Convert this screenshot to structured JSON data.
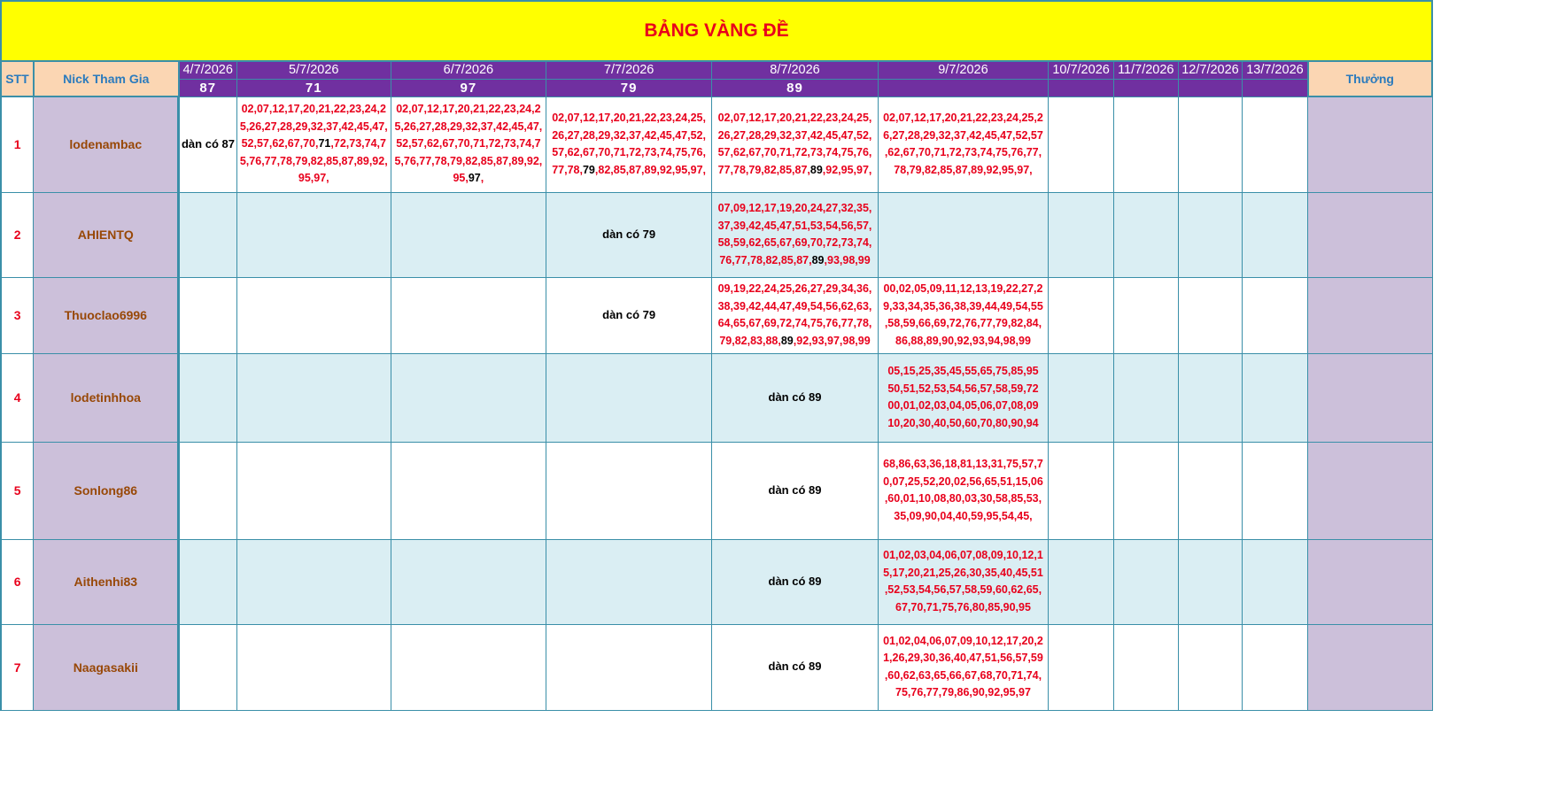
{
  "title": "BẢNG VÀNG ĐỀ",
  "headers": {
    "stt": "STT",
    "nick": "Nick Tham Gia",
    "reward": "Thưởng"
  },
  "dates": [
    "4/7/2026",
    "5/7/2026",
    "6/7/2026",
    "7/7/2026",
    "8/7/2026",
    "9/7/2026",
    "10/7/2026",
    "11/7/2026",
    "12/7/2026",
    "13/7/2026"
  ],
  "results": [
    "87",
    "71",
    "97",
    "79",
    "89",
    "",
    "",
    "",
    "",
    ""
  ],
  "rows": [
    {
      "stt": "1",
      "nick": "lodenambac",
      "cells": [
        {
          "note": "dàn có 87"
        },
        {
          "parts": [
            "02,07,12,17,20,21,22,23,24,25,26,27,28,29,32,37,42,45,47,52,57,62,67,70,",
            "71",
            ",72,73,74,75,76,77,78,79,82,85,87,89,92,95,97,"
          ]
        },
        {
          "parts": [
            "02,07,12,17,20,21,22,23,24,25,26,27,28,29,32,37,42,45,47,52,57,62,67,70,71,72,73,74,75,76,77,78,79,82,85,87,89,92,95,",
            "97",
            ","
          ]
        },
        {
          "parts": [
            "02,07,12,17,20,21,22,23,24,25,26,27,28,29,32,37,42,45,47,52,57,62,67,70,71,72,73,74,75,76,77,78,",
            "79",
            ",82,85,87,89,92,95,97,"
          ]
        },
        {
          "parts": [
            "02,07,12,17,20,21,22,23,24,25,26,27,28,29,32,37,42,45,47,52,57,62,67,70,71,72,73,74,75,76,77,78,79,82,85,87,",
            "89",
            ",92,95,97,"
          ]
        },
        {
          "parts": [
            "02,07,12,17,20,21,22,23,24,25,26,27,28,29,32,37,42,45,47,52,57,62,67,70,71,72,73,74,75,76,77,78,79,82,85,87,89,92,95,97,"
          ]
        },
        {},
        {},
        {},
        {}
      ]
    },
    {
      "stt": "2",
      "nick": "AHIENTQ",
      "cells": [
        {},
        {},
        {},
        {
          "note": "dàn có 79"
        },
        {
          "parts": [
            "07,09,12,17,19,20,24,27,32,35,37,39,42,45,47,51,53,54,56,57,58,59,62,65,67,69,70,72,73,74,76,77,78,82,85,87,",
            "89",
            ",93,98,99"
          ]
        },
        {},
        {},
        {},
        {},
        {}
      ]
    },
    {
      "stt": "3",
      "nick": "Thuoclao6996",
      "cells": [
        {},
        {},
        {},
        {
          "note": "dàn có 79"
        },
        {
          "parts": [
            "09,19,22,24,25,26,27,29,34,36,38,39,42,44,47,49,54,56,62,63,64,65,67,69,72,74,75,76,77,78,79,82,83,88,",
            "89",
            ",92,93,97,98,99"
          ]
        },
        {
          "parts": [
            "00,02,05,09,11,12,13,19,22,27,29,33,34,35,36,38,39,44,49,54,55,58,59,66,69,72,76,77,79,82,84,86,88,89,90,92,93,94,98,99"
          ]
        },
        {},
        {},
        {},
        {}
      ]
    },
    {
      "stt": "4",
      "nick": "lodetinhhoa",
      "cells": [
        {},
        {},
        {},
        {},
        {
          "note": "dàn có 89"
        },
        {
          "lines": [
            "05,15,25,35,45,55,65,75,85,95",
            "50,51,52,53,54,56,57,58,59,72",
            "00,01,02,03,04,05,06,07,08,09",
            "10,20,30,40,50,60,70,80,90,94"
          ]
        },
        {},
        {},
        {},
        {}
      ]
    },
    {
      "stt": "5",
      "nick": "Sonlong86",
      "cells": [
        {},
        {},
        {},
        {},
        {
          "note": "dàn có 89"
        },
        {
          "parts": [
            "68,86,63,36,18,81,13,31,75,57,70,07,25,52,20,02,56,65,51,15,06,60,01,10,08,80,03,30,58,85,53,35,09,90,04,40,59,95,54,45,"
          ]
        },
        {},
        {},
        {},
        {}
      ]
    },
    {
      "stt": "6",
      "nick": "Aithenhi83",
      "cells": [
        {},
        {},
        {},
        {},
        {
          "note": "dàn có 89"
        },
        {
          "parts": [
            "01,02,03,04,06,07,08,09,10,12,15,17,20,21,25,26,30,35,40,45,51,52,53,54,56,57,58,59,60,62,65,67,70,71,75,76,80,85,90,95"
          ]
        },
        {},
        {},
        {},
        {}
      ]
    },
    {
      "stt": "7",
      "nick": "Naagasakii",
      "cells": [
        {},
        {},
        {},
        {},
        {
          "note": "dàn có 89"
        },
        {
          "parts": [
            "01,02,04,06,07,09,10,12,17,20,21,26,29,30,36,40,47,51,56,57,59,60,62,63,65,66,67,68,70,71,74,75,76,77,79,86,90,92,95,97"
          ]
        },
        {},
        {},
        {},
        {}
      ]
    }
  ]
}
